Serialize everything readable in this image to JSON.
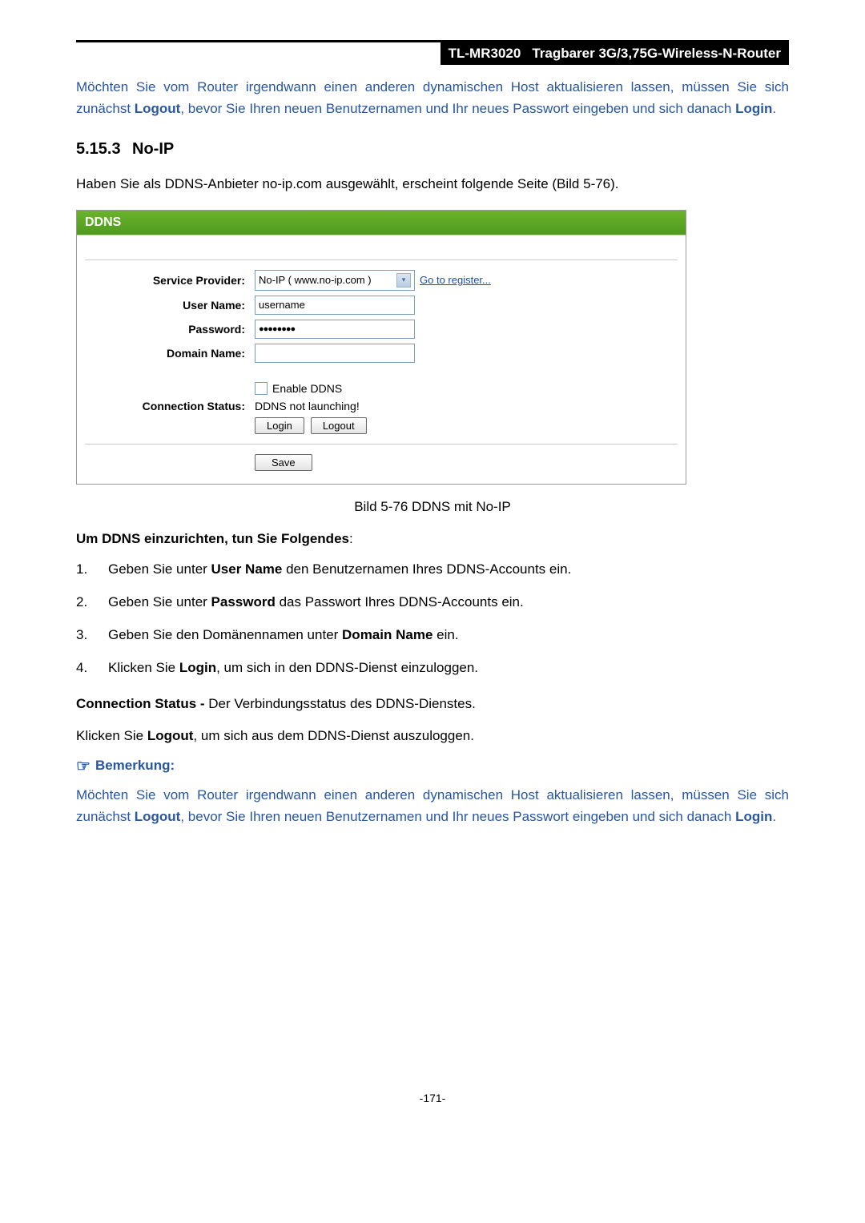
{
  "header": {
    "model": "TL-MR3020",
    "title": "Tragbarer 3G/3,75G-Wireless-N-Router"
  },
  "intro_note": {
    "p1": "Möchten Sie vom Router irgendwann einen anderen dynamischen Host aktualisieren lassen, müssen Sie sich zunächst ",
    "logout": "Logout",
    "p2": ", bevor Sie Ihren neuen Benutzernamen und Ihr neues Passwort eingeben und sich danach ",
    "login": "Login",
    "p3": "."
  },
  "section": {
    "number": "5.15.3",
    "title": "No-IP"
  },
  "intro_line": "Haben Sie als DDNS-Anbieter no-ip.com ausgewählt, erscheint folgende Seite (Bild 5-76).",
  "figure": {
    "panel_title": "DDNS",
    "labels": {
      "service_provider": "Service Provider:",
      "user_name": "User Name:",
      "password": "Password:",
      "domain_name": "Domain Name:",
      "connection_status": "Connection Status:"
    },
    "values": {
      "service_provider_value": "No-IP ( www.no-ip.com )",
      "register_link": "Go to register...",
      "user_name_value": "username",
      "password_display": "●●●●●●●●",
      "domain_name_value": "",
      "enable_ddns": "Enable DDNS",
      "status_text": "DDNS not launching!",
      "login_btn": "Login",
      "logout_btn": "Logout",
      "save_btn": "Save"
    }
  },
  "caption": "Bild 5-76 DDNS mit No-IP",
  "instructions_heading": "Um DDNS einzurichten, tun Sie Folgendes",
  "instructions_colon": ":",
  "steps": {
    "s1a": "Geben Sie unter ",
    "s1b": "User Name",
    "s1c": " den Benutzernamen Ihres DDNS-Accounts ein.",
    "s2a": "Geben Sie unter ",
    "s2b": "Password",
    "s2c": " das Passwort Ihres DDNS-Accounts ein.",
    "s3a": "Geben Sie den Domänennamen unter ",
    "s3b": "Domain Name",
    "s3c": " ein.",
    "s4a": "Klicken Sie ",
    "s4b": "Login",
    "s4c": ", um sich in den DDNS-Dienst einzuloggen."
  },
  "conn_status": {
    "label": "Connection Status - ",
    "text": "Der Verbindungsstatus des DDNS-Dienstes."
  },
  "logout_line": {
    "a": "Klicken Sie ",
    "b": "Logout",
    "c": ", um sich aus dem DDNS-Dienst auszuloggen."
  },
  "note_label": "Bemerkung:",
  "page_number": "-171-"
}
